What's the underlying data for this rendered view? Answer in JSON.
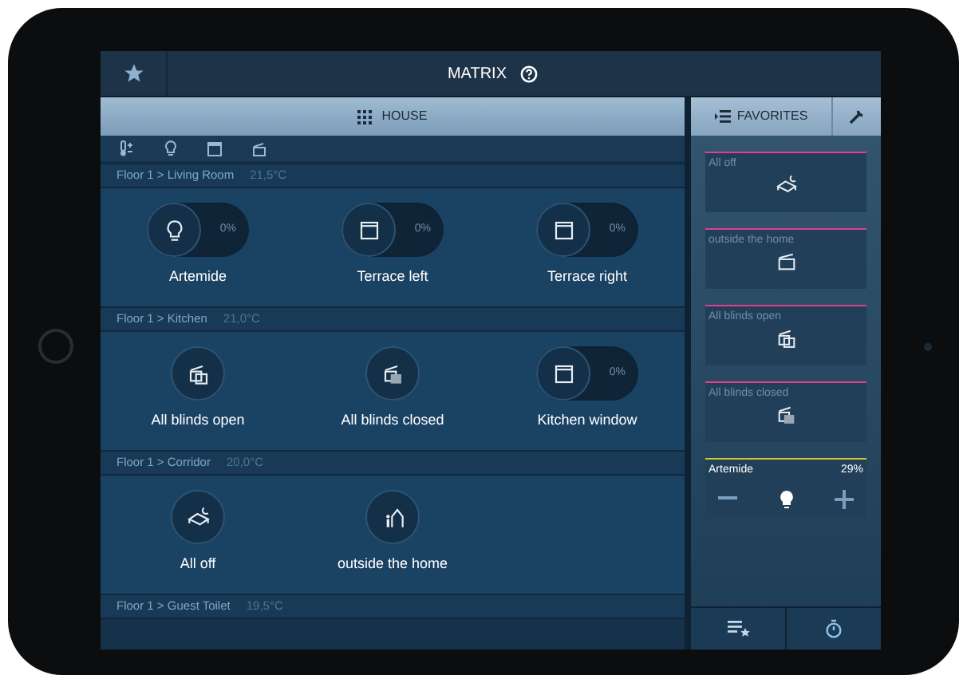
{
  "top_bar": {
    "title": "MATRIX"
  },
  "house_tab": {
    "label": "HOUSE"
  },
  "rooms": [
    {
      "path": "Floor 1 > Living Room",
      "temperature": "21,5°C",
      "devices": [
        {
          "name": "Artemide",
          "kind": "lamp",
          "reading": "0%"
        },
        {
          "name": "Terrace left",
          "kind": "window",
          "reading": "0%"
        },
        {
          "name": "Terrace right",
          "kind": "window",
          "reading": "0%"
        }
      ]
    },
    {
      "path": "Floor 1 > Kitchen",
      "temperature": "21,0°C",
      "devices": [
        {
          "name": "All blinds open",
          "kind": "blinds-open"
        },
        {
          "name": "All blinds closed",
          "kind": "blinds-closed"
        },
        {
          "name": "Kitchen window",
          "kind": "window",
          "reading": "0%"
        }
      ]
    },
    {
      "path": "Floor 1 > Corridor",
      "temperature": "20,0°C",
      "devices": [
        {
          "name": "All off",
          "kind": "night"
        },
        {
          "name": "outside the home",
          "kind": "leave"
        }
      ]
    },
    {
      "path": "Floor 1 > Guest Toilet",
      "temperature": "19,5°C"
    }
  ],
  "favorites_tab": {
    "label": "FAVORITES"
  },
  "favorites": [
    {
      "label": "All off",
      "kind": "night",
      "color": "#e0408a"
    },
    {
      "label": "outside the home",
      "kind": "blinds-single",
      "color": "#e0408a"
    },
    {
      "label": "All blinds open",
      "kind": "blinds-open",
      "color": "#e0408a"
    },
    {
      "label": "All blinds closed",
      "kind": "blinds-closed",
      "color": "#e0408a"
    },
    {
      "label": "Artemide",
      "kind": "dimmer",
      "reading": "29%",
      "color": "#c8c830"
    }
  ]
}
